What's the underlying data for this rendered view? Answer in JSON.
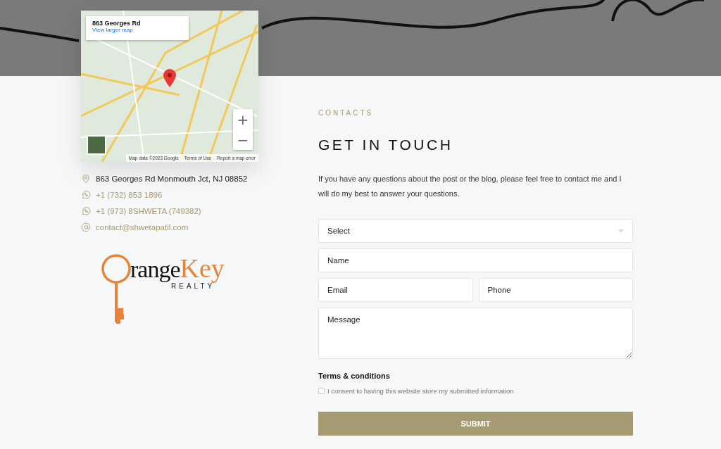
{
  "map": {
    "place_title": "863 Georges Rd",
    "larger_map_link": "View larger map",
    "zoom_in": "+",
    "zoom_out": "−",
    "attribution": [
      "Map data ©2023 Google",
      "Terms of Use",
      "Report a map error"
    ]
  },
  "contacts": [
    {
      "kind": "address",
      "text": "863 Georges Rd Monmouth Jct, NJ 08852"
    },
    {
      "kind": "phone",
      "text": "+1 (732) 853 1896"
    },
    {
      "kind": "phone",
      "text": "+1 (973) 8SHWETA (749382)"
    },
    {
      "kind": "email",
      "text": "contact@shwetapatil.com"
    }
  ],
  "logo": {
    "word_1": "range",
    "word_2": "Key",
    "tagline": "REALTY"
  },
  "section": {
    "eyebrow": "CONTACTS",
    "heading": "GET IN TOUCH",
    "intro": "If you have any questions about the post or the blog, please feel free to contact me and I will do my best to answer your questions."
  },
  "form": {
    "select": {
      "value": "Select"
    },
    "name": {
      "placeholder": "Name"
    },
    "email": {
      "placeholder": "Email"
    },
    "phone": {
      "placeholder": "Phone"
    },
    "message": {
      "placeholder": "Message"
    },
    "terms_title": "Terms & conditions",
    "consent": {
      "label": "I consent to having this website store my submitted information",
      "checked": false
    },
    "submit": "SUBMIT"
  }
}
